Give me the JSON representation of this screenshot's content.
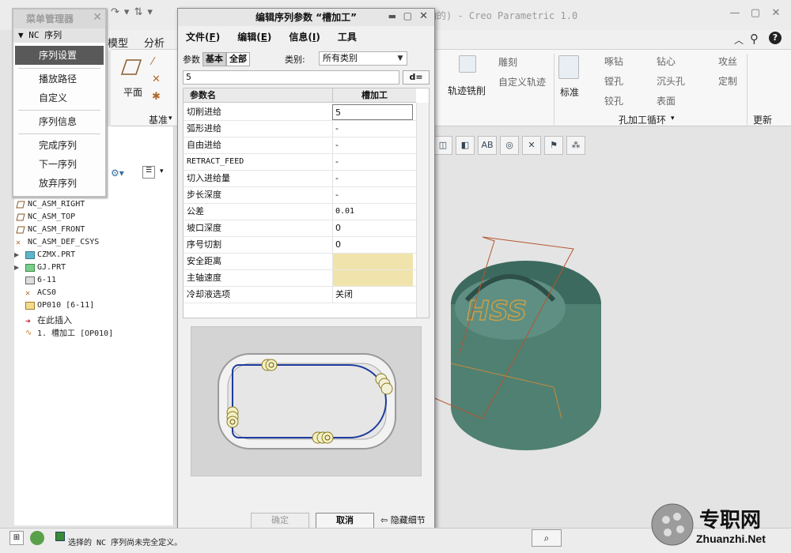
{
  "app": {
    "title": "动的) - Creo Parametric 1.0"
  },
  "ribbon": {
    "tabs": [
      {
        "label": "模型"
      },
      {
        "label": "分析"
      }
    ],
    "items": {
      "plane": "平面",
      "datum_group": "基准",
      "engrave": "雕刻",
      "custom_traj": "自定义轨迹",
      "traj_mill": "轨迹铣削",
      "standard": "标准",
      "woodpecker": "啄钻",
      "spot": "钻心",
      "tap": "攻丝",
      "bore": "镗孔",
      "countersink": "沉头孔",
      "custom": "定制",
      "ream": "铰孔",
      "face": "表面",
      "hole_cycle": "孔加工循环",
      "update": "更新"
    }
  },
  "menu_manager": {
    "title": "菜单管理器",
    "header": "NC 序列",
    "items": [
      {
        "label": "序列设置",
        "selected": true
      },
      {
        "label": "播放路径"
      },
      {
        "label": "自定义"
      },
      {
        "label": "序列信息"
      },
      {
        "label": "完成序列"
      },
      {
        "label": "下一序列"
      },
      {
        "label": "放弃序列"
      }
    ]
  },
  "tree": [
    {
      "label": "NC_ASM_RIGHT",
      "icon": "datum-plane-icon"
    },
    {
      "label": "NC_ASM_TOP",
      "icon": "datum-plane-icon"
    },
    {
      "label": "NC_ASM_FRONT",
      "icon": "datum-plane-icon"
    },
    {
      "label": "NC_ASM_DEF_CSYS",
      "icon": "csys-icon"
    },
    {
      "label": "CZMX.PRT",
      "icon": "part-icon"
    },
    {
      "label": "GJ.PRT",
      "icon": "part-icon"
    },
    {
      "label": "6-11",
      "icon": "workcell-icon"
    },
    {
      "label": "ACS0",
      "icon": "csys-icon"
    },
    {
      "label": "OP010 [6-11]",
      "icon": "operation-icon"
    },
    {
      "label": "在此插入",
      "icon": "insert-arrow-icon"
    },
    {
      "label": "1. 槽加工 [OP010]",
      "icon": "sequence-icon"
    }
  ],
  "dialog": {
    "title": "编辑序列参数 “槽加工”",
    "menu": [
      {
        "label": "文件",
        "key": "F"
      },
      {
        "label": "编辑",
        "key": "E"
      },
      {
        "label": "信息",
        "key": "I"
      },
      {
        "label": "工具"
      }
    ],
    "params_label": "参数",
    "basic_btn": "基本",
    "all_btn": "全部",
    "category_label": "类别:",
    "category_value": "所有类别",
    "input_value": "5",
    "deq_btn": "d=",
    "table": {
      "headers": [
        "参数名",
        "槽加工"
      ],
      "rows": [
        {
          "name": "切削进给",
          "value": "5"
        },
        {
          "name": "弧形进给",
          "value": "-"
        },
        {
          "name": "自由进给",
          "value": "-"
        },
        {
          "name": "RETRACT_FEED",
          "value": "-"
        },
        {
          "name": "切入进给量",
          "value": "-"
        },
        {
          "name": "步长深度",
          "value": "-"
        },
        {
          "name": "公差",
          "value": "0.01"
        },
        {
          "name": "坡口深度",
          "value": "0"
        },
        {
          "name": "序号切割",
          "value": "0"
        },
        {
          "name": "安全距离",
          "value": ""
        },
        {
          "name": "主轴速度",
          "value": ""
        },
        {
          "name": "冷却液选项",
          "value": "关闭"
        }
      ]
    },
    "ok": "确定",
    "cancel": "取消",
    "hide": "隐藏细节"
  },
  "status": {
    "message": "选择的 NC 序列尚未完全定义。"
  },
  "watermark": {
    "cn": "专职网",
    "url": "Zhuanzhi.Net"
  },
  "colors": {
    "highlight": "#f0e4ac",
    "menu_selected": "#595959",
    "part": "#4f8072",
    "path": "#1d3c9c"
  }
}
